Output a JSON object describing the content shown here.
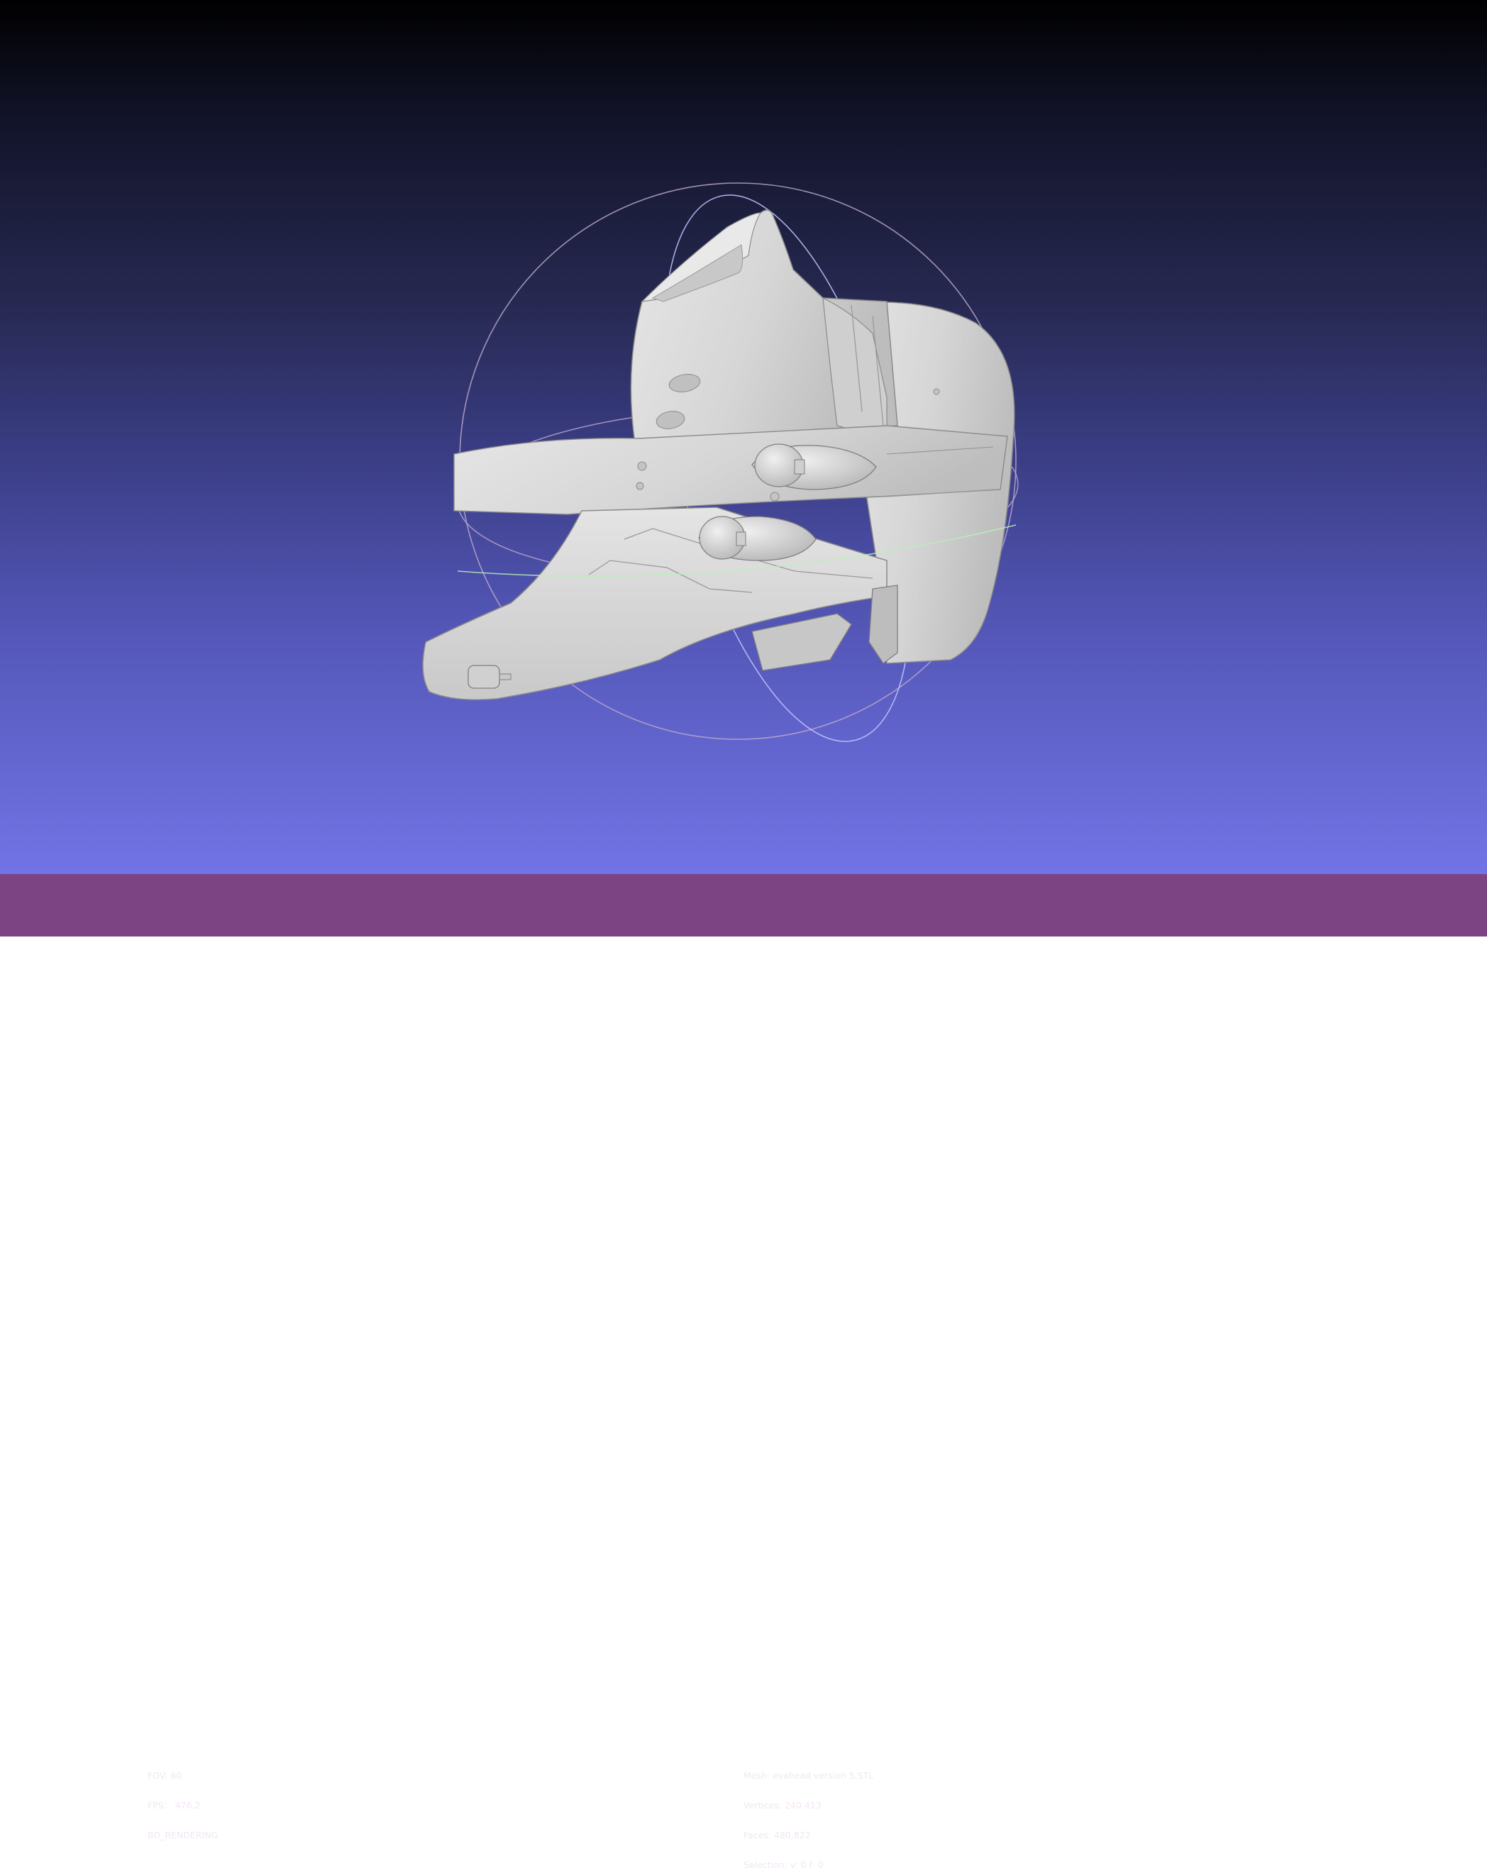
{
  "viewer": {
    "background_gradient": [
      "#000000",
      "#262850",
      "#5356b6",
      "#7274e6"
    ],
    "model_color": "#d9d9d9",
    "trackball": {
      "color_outer": "#b9a6c9",
      "color_vertical": "#c3c6ff",
      "color_horizontal": "#b9f0b9"
    }
  },
  "status_bar": {
    "color": "#7d4484",
    "left": {
      "fov": "FOV: 60",
      "fps": "FPS:   476.2",
      "rendering": "BO_RENDERING"
    },
    "right": {
      "mesh": "Mesh: evahead version 5.STL",
      "vertices": "Vertices: 240,413",
      "faces": "Faces: 480,822",
      "selection": "Selection: v: 0 f: 0"
    }
  }
}
